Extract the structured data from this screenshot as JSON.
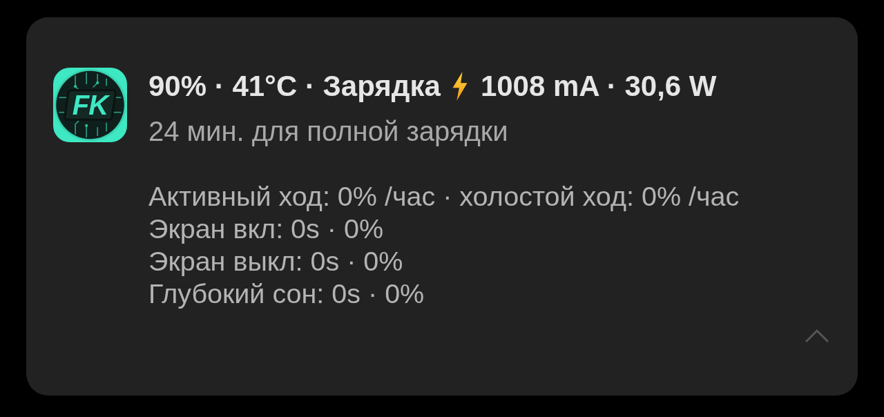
{
  "notification": {
    "app_icon": {
      "label": "FK"
    },
    "status": "90% · 41°C · Зарядка",
    "charging": true,
    "charge_info": "1008 mA · 30,6 W",
    "subtitle": "24 мин. для полной зарядки",
    "details": [
      "Активный ход: 0% /час · холостой ход: 0% /час",
      "Экран вкл: 0s · 0%",
      "Экран выкл: 0s · 0%",
      "Глубокий сон: 0s · 0%"
    ],
    "expanded": true
  }
}
